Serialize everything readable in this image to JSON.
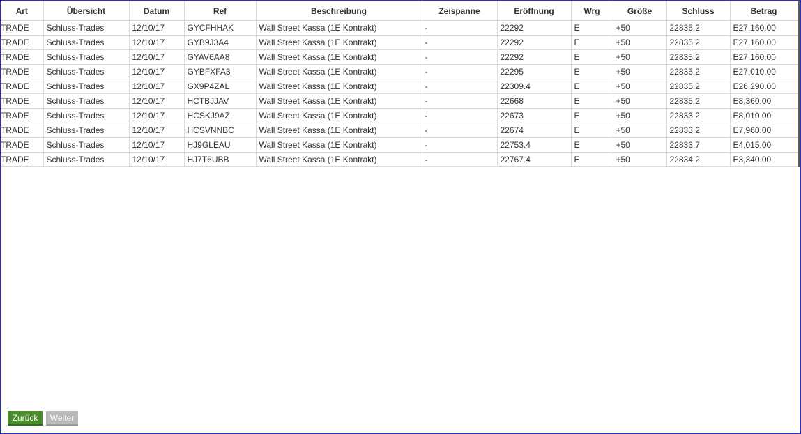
{
  "table": {
    "columns": [
      "Art",
      "Übersicht",
      "Datum",
      "Ref",
      "Beschreibung",
      "Zeispanne",
      "Eröffnung",
      "Wrg",
      "Größe",
      "Schluss",
      "Betrag"
    ],
    "rows": [
      [
        "TRADE",
        "Schluss-Trades",
        "12/10/17",
        "GYCFHHAK",
        "Wall Street Kassa (1E Kontrakt)",
        "-",
        "22292",
        "E",
        "+50",
        "22835.2",
        "E27,160.00"
      ],
      [
        "TRADE",
        "Schluss-Trades",
        "12/10/17",
        "GYB9J3A4",
        "Wall Street Kassa (1E Kontrakt)",
        "-",
        "22292",
        "E",
        "+50",
        "22835.2",
        "E27,160.00"
      ],
      [
        "TRADE",
        "Schluss-Trades",
        "12/10/17",
        "GYAV6AA8",
        "Wall Street Kassa (1E Kontrakt)",
        "-",
        "22292",
        "E",
        "+50",
        "22835.2",
        "E27,160.00"
      ],
      [
        "TRADE",
        "Schluss-Trades",
        "12/10/17",
        "GYBFXFA3",
        "Wall Street Kassa (1E Kontrakt)",
        "-",
        "22295",
        "E",
        "+50",
        "22835.2",
        "E27,010.00"
      ],
      [
        "TRADE",
        "Schluss-Trades",
        "12/10/17",
        "GX9P4ZAL",
        "Wall Street Kassa (1E Kontrakt)",
        "-",
        "22309.4",
        "E",
        "+50",
        "22835.2",
        "E26,290.00"
      ],
      [
        "TRADE",
        "Schluss-Trades",
        "12/10/17",
        "HCTBJJAV",
        "Wall Street Kassa (1E Kontrakt)",
        "-",
        "22668",
        "E",
        "+50",
        "22835.2",
        "E8,360.00"
      ],
      [
        "TRADE",
        "Schluss-Trades",
        "12/10/17",
        "HCSKJ9AZ",
        "Wall Street Kassa (1E Kontrakt)",
        "-",
        "22673",
        "E",
        "+50",
        "22833.2",
        "E8,010.00"
      ],
      [
        "TRADE",
        "Schluss-Trades",
        "12/10/17",
        "HCSVNNBC",
        "Wall Street Kassa (1E Kontrakt)",
        "-",
        "22674",
        "E",
        "+50",
        "22833.2",
        "E7,960.00"
      ],
      [
        "TRADE",
        "Schluss-Trades",
        "12/10/17",
        "HJ9GLEAU",
        "Wall Street Kassa (1E Kontrakt)",
        "-",
        "22753.4",
        "E",
        "+50",
        "22833.7",
        "E4,015.00"
      ],
      [
        "TRADE",
        "Schluss-Trades",
        "12/10/17",
        "HJ7T6UBB",
        "Wall Street Kassa (1E Kontrakt)",
        "-",
        "22767.4",
        "E",
        "+50",
        "22834.2",
        "E3,340.00"
      ]
    ]
  },
  "pagination": {
    "back_label": "Zurück",
    "next_label": "Weiter"
  },
  "colors": {
    "back_button": "#4b8c2f",
    "next_button_disabled": "#b9b9b9",
    "window_border": "#2c2cc4"
  }
}
